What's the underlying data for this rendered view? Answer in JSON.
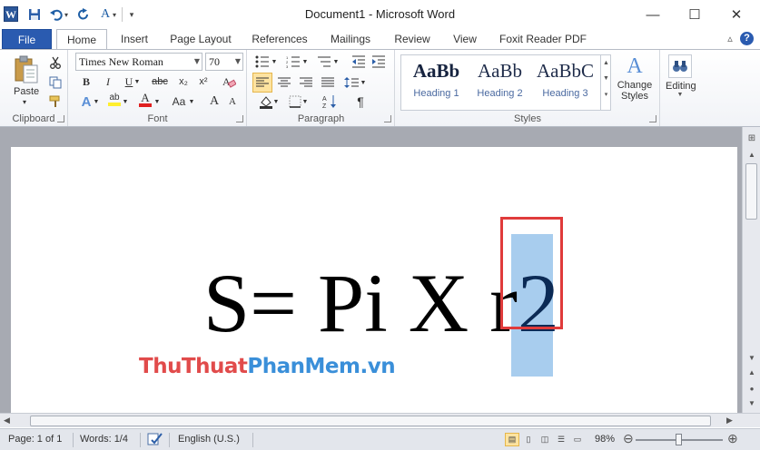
{
  "window": {
    "title": "Document1 - Microsoft Word",
    "minimize_glyph": "—",
    "maximize_glyph": "☐",
    "close_glyph": "✕"
  },
  "quick_access": {
    "save_icon": "save-icon",
    "undo_icon": "undo-icon",
    "redo_icon": "repeat-icon",
    "format_icon": "font-format-icon"
  },
  "tabs": {
    "file": "File",
    "items": [
      "Home",
      "Insert",
      "Page Layout",
      "References",
      "Mailings",
      "Review",
      "View",
      "Foxit Reader PDF"
    ],
    "active": "Home"
  },
  "ribbon": {
    "clipboard": {
      "label": "Clipboard",
      "paste": "Paste"
    },
    "font": {
      "label": "Font",
      "font_name": "Times New Roman",
      "font_size": "70",
      "bold": "B",
      "italic": "I",
      "underline": "U",
      "strike": "abc",
      "subscript": "x₂",
      "superscript": "x²",
      "grow": "A",
      "shrink": "A",
      "change_case": "Aa",
      "font_color": "A",
      "highlight": "ab",
      "effects": "A",
      "clear": "A"
    },
    "paragraph": {
      "label": "Paragraph",
      "show_marks": "¶"
    },
    "styles": {
      "label": "Styles",
      "items": [
        {
          "sample": "AaBb",
          "name": "Heading 1"
        },
        {
          "sample": "AaBb",
          "name": "Heading 2"
        },
        {
          "sample": "AaBbC",
          "name": "Heading 3"
        }
      ],
      "change_styles_line1": "Change",
      "change_styles_line2": "Styles"
    },
    "editing": {
      "label": "Editing"
    }
  },
  "document": {
    "formula_text": "S= Pi X r",
    "selected_text": "2",
    "watermark_part1": "ThuThuat",
    "watermark_part2": "PhanMem.vn"
  },
  "statusbar": {
    "page": "Page: 1 of 1",
    "words": "Words: 1/4",
    "language": "English (U.S.)",
    "zoom": "98%",
    "zoom_value": 98
  },
  "colors": {
    "file_tab": "#2a5bb0",
    "selection": "#a8cdee",
    "callout_border": "#e03b3b",
    "watermark_red": "#e14b4b",
    "watermark_blue": "#3a8fd9"
  }
}
